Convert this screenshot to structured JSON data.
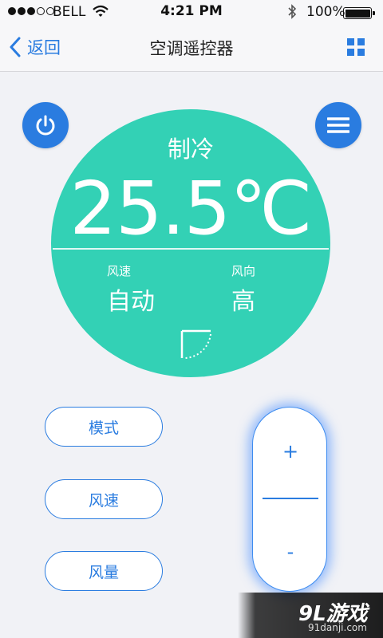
{
  "status_bar": {
    "carrier": "BELL",
    "time": "4:21 PM",
    "battery": "100%",
    "icons": [
      "signal-dots-icon",
      "wifi-icon",
      "bluetooth-icon",
      "battery-icon"
    ]
  },
  "nav": {
    "back_label": "返回",
    "title": "空调遥控器",
    "icons": [
      "chevron-left-icon",
      "grid-icon"
    ]
  },
  "controls": {
    "power_icon": "power-icon",
    "menu_icon": "menu-icon"
  },
  "display": {
    "mode": "制冷",
    "temperature": "25.5℃",
    "speed_label": "风速",
    "speed_value": "自动",
    "direction_label": "风向",
    "direction_value": "高",
    "swing_icon": "swing-direction-icon"
  },
  "buttons": {
    "mode": "模式",
    "speed": "风速",
    "volume": "风量"
  },
  "temp_control": {
    "plus": "+",
    "minus": "-"
  },
  "watermark": {
    "logo": "9L游戏",
    "url": "91danji.com"
  },
  "colors": {
    "accent": "#2a7ce0",
    "display": "#33d1b5",
    "background": "#f1f2f6"
  }
}
